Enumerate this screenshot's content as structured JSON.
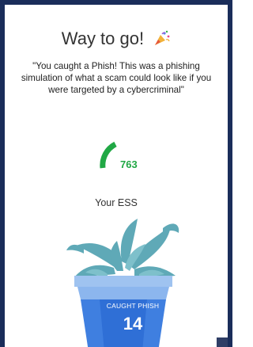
{
  "header": {
    "title": "Way to go!",
    "celebration_icon": "party-popper-icon"
  },
  "message": "\"You caught a Phish! This was a phishing simulation of what a scam could look like if you were targeted by a cybercriminal\"",
  "score": {
    "value": "763",
    "label": "Your ESS",
    "color": "#21a845"
  },
  "pot": {
    "label": "CAUGHT PHISH",
    "count": "14",
    "color_top": "#9fc3f0",
    "color_band": "#3f7fe0"
  },
  "colors": {
    "frame": "#1a2d5a",
    "leaves": "#5fa9b7"
  }
}
